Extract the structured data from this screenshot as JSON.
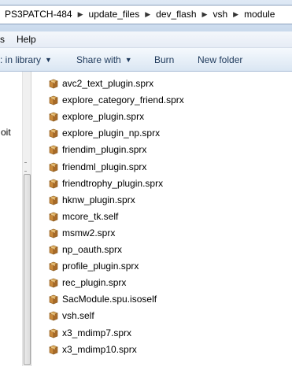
{
  "breadcrumb": [
    {
      "label": "PS3PATCH-484"
    },
    {
      "label": "update_files"
    },
    {
      "label": "dev_flash"
    },
    {
      "label": "vsh"
    },
    {
      "label": "module"
    }
  ],
  "menu": {
    "left_fragment": "s",
    "help": "Help"
  },
  "toolbar": {
    "library": ": in library",
    "share": "Share with",
    "burn": "Burn",
    "new_folder": "New folder"
  },
  "nav": {
    "fragment": "oit"
  },
  "files": [
    {
      "name": "avc2_text_plugin.sprx",
      "icon": "package-icon"
    },
    {
      "name": "explore_category_friend.sprx",
      "icon": "package-icon"
    },
    {
      "name": "explore_plugin.sprx",
      "icon": "package-icon"
    },
    {
      "name": "explore_plugin_np.sprx",
      "icon": "package-icon"
    },
    {
      "name": "friendim_plugin.sprx",
      "icon": "package-icon"
    },
    {
      "name": "friendml_plugin.sprx",
      "icon": "package-icon"
    },
    {
      "name": "friendtrophy_plugin.sprx",
      "icon": "package-icon"
    },
    {
      "name": "hknw_plugin.sprx",
      "icon": "package-icon"
    },
    {
      "name": "mcore_tk.self",
      "icon": "package-icon"
    },
    {
      "name": "msmw2.sprx",
      "icon": "package-icon"
    },
    {
      "name": "np_oauth.sprx",
      "icon": "package-icon"
    },
    {
      "name": "profile_plugin.sprx",
      "icon": "package-icon"
    },
    {
      "name": "rec_plugin.sprx",
      "icon": "package-icon"
    },
    {
      "name": "SacModule.spu.isoself",
      "icon": "package-icon"
    },
    {
      "name": "vsh.self",
      "icon": "package-icon"
    },
    {
      "name": "x3_mdimp7.sprx",
      "icon": "package-icon"
    },
    {
      "name": "x3_mdimp10.sprx",
      "icon": "package-icon"
    }
  ]
}
